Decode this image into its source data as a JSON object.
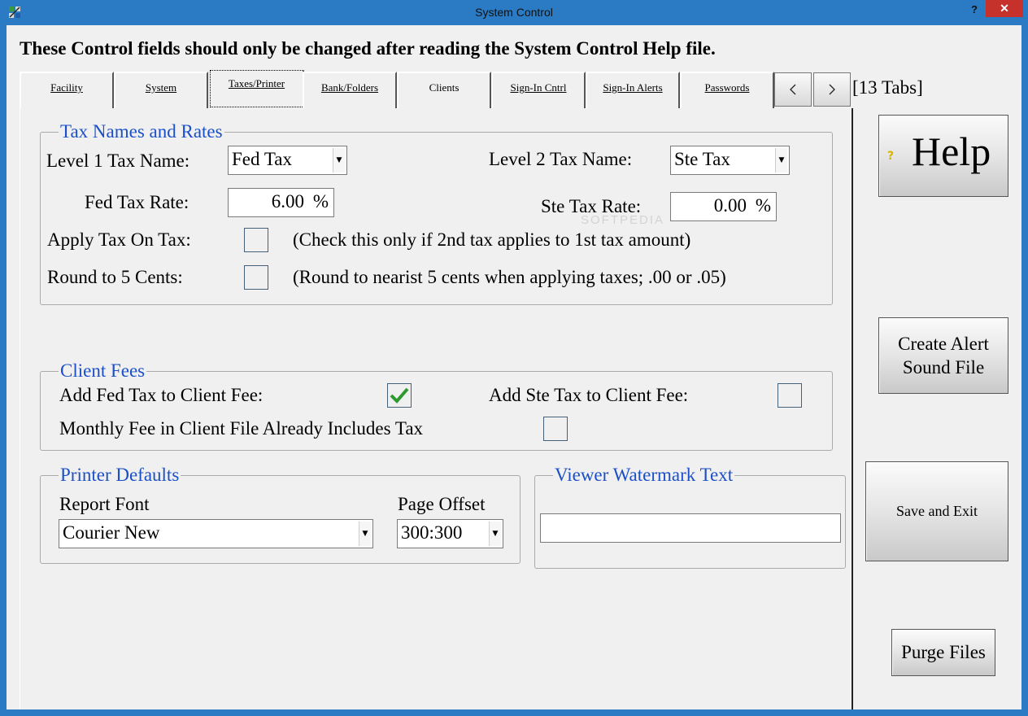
{
  "window": {
    "title": "System Control",
    "help_glyph": "?",
    "close_glyph": "✕"
  },
  "warning": "These Control fields should only be changed after reading the System Control Help file.",
  "tabs": [
    {
      "label": "Facility"
    },
    {
      "label": "System"
    },
    {
      "label": "Taxes/Printer",
      "active": true
    },
    {
      "label": "Bank/Folders"
    },
    {
      "label": "Clients"
    },
    {
      "label": "Sign-In Cntrl"
    },
    {
      "label": "Sign-In Alerts"
    },
    {
      "label": "Passwords"
    }
  ],
  "tab_count": "[13 Tabs]",
  "tax": {
    "legend": "Tax Names and Rates",
    "level1_label": "Level 1 Tax Name:",
    "level1_value": "Fed Tax",
    "level2_label": "Level 2 Tax Name:",
    "level2_value": "Ste Tax",
    "fed_rate_label": "Fed Tax Rate:",
    "fed_rate_value": "6.00",
    "ste_rate_label": "Ste Tax Rate:",
    "ste_rate_value": "0.00",
    "percent": "%",
    "apply_tax_label": "Apply Tax On Tax:",
    "apply_tax_checked": false,
    "apply_tax_note": "(Check this only if 2nd tax applies to 1st tax amount)",
    "round_label": "Round to 5 Cents:",
    "round_checked": false,
    "round_note": "(Round to nearist 5 cents when applying taxes; .00 or .05)"
  },
  "fees": {
    "legend": "Client Fees",
    "add_fed_label": "Add Fed Tax to Client Fee:",
    "add_fed_checked": true,
    "add_ste_label": "Add Ste Tax to Client Fee:",
    "add_ste_checked": false,
    "monthly_label": "Monthly Fee in Client File Already Includes Tax",
    "monthly_checked": false
  },
  "printer": {
    "legend": "Printer Defaults",
    "font_label": "Report Font",
    "font_value": "Courier New",
    "offset_label": "Page Offset",
    "offset_value": "300:300"
  },
  "viewer": {
    "legend": "Viewer Watermark Text",
    "value": ""
  },
  "buttons": {
    "help": "Help",
    "help_icon_glyph": "?",
    "create_alert_line1": "Create Alert",
    "create_alert_line2": "Sound File",
    "save_exit": "Save and Exit",
    "purge": "Purge Files"
  },
  "watermark": "SOFTPEDIA",
  "colors": {
    "title_bar": "#2a7bc4",
    "legend_text": "#1a4fc7",
    "close_button": "#c7312b",
    "check_green": "#2e9a2e"
  }
}
